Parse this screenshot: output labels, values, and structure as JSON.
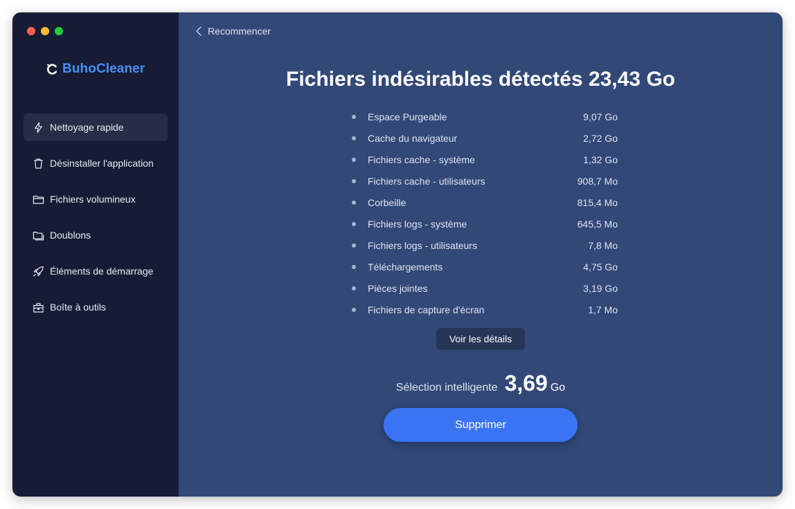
{
  "app": {
    "name": "BuhoCleaner",
    "brand_color": "#4a8cf5"
  },
  "sidebar": {
    "items": [
      {
        "label": "Nettoyage rapide",
        "icon": "bolt-icon",
        "active": true
      },
      {
        "label": "Désinstaller l'application",
        "icon": "trash-icon",
        "active": false
      },
      {
        "label": "Fichiers volumineux",
        "icon": "folder-icon",
        "active": false
      },
      {
        "label": "Doublons",
        "icon": "duplicate-folder-icon",
        "active": false
      },
      {
        "label": "Éléments de démarrage",
        "icon": "rocket-icon",
        "active": false
      },
      {
        "label": "Boîte à outils",
        "icon": "toolbox-icon",
        "active": false
      }
    ]
  },
  "main": {
    "back_label": "Recommencer",
    "headline": {
      "text": "Fichiers indésirables détectés",
      "amount": "23,43",
      "unit": "Go"
    },
    "junk_items": [
      {
        "name": "Espace Purgeable",
        "size": "9,07 Go"
      },
      {
        "name": "Cache du navigateur",
        "size": "2,72 Go"
      },
      {
        "name": "Fichiers cache - système",
        "size": "1,32 Go"
      },
      {
        "name": "Fichiers cache - utilisateurs",
        "size": "908,7 Mo"
      },
      {
        "name": "Corbeille",
        "size": "815,4 Mo"
      },
      {
        "name": "Fichiers logs - système",
        "size": "645,5 Mo"
      },
      {
        "name": "Fichiers logs - utilisateurs",
        "size": "7,8 Mo"
      },
      {
        "name": "Téléchargements",
        "size": "4,75 Go"
      },
      {
        "name": "Pièces jointes",
        "size": "3,19 Go"
      },
      {
        "name": "Fichiers de capture d'écran",
        "size": "1,7 Mo"
      }
    ],
    "details_button": "Voir les détails",
    "smart_selection": {
      "label": "Sélection intelligente",
      "value": "3,69",
      "unit": "Go"
    },
    "delete_button": "Supprimer"
  },
  "colors": {
    "sidebar_bg": "#161c33",
    "main_bg": "#324877",
    "accent": "#3a74f3"
  }
}
